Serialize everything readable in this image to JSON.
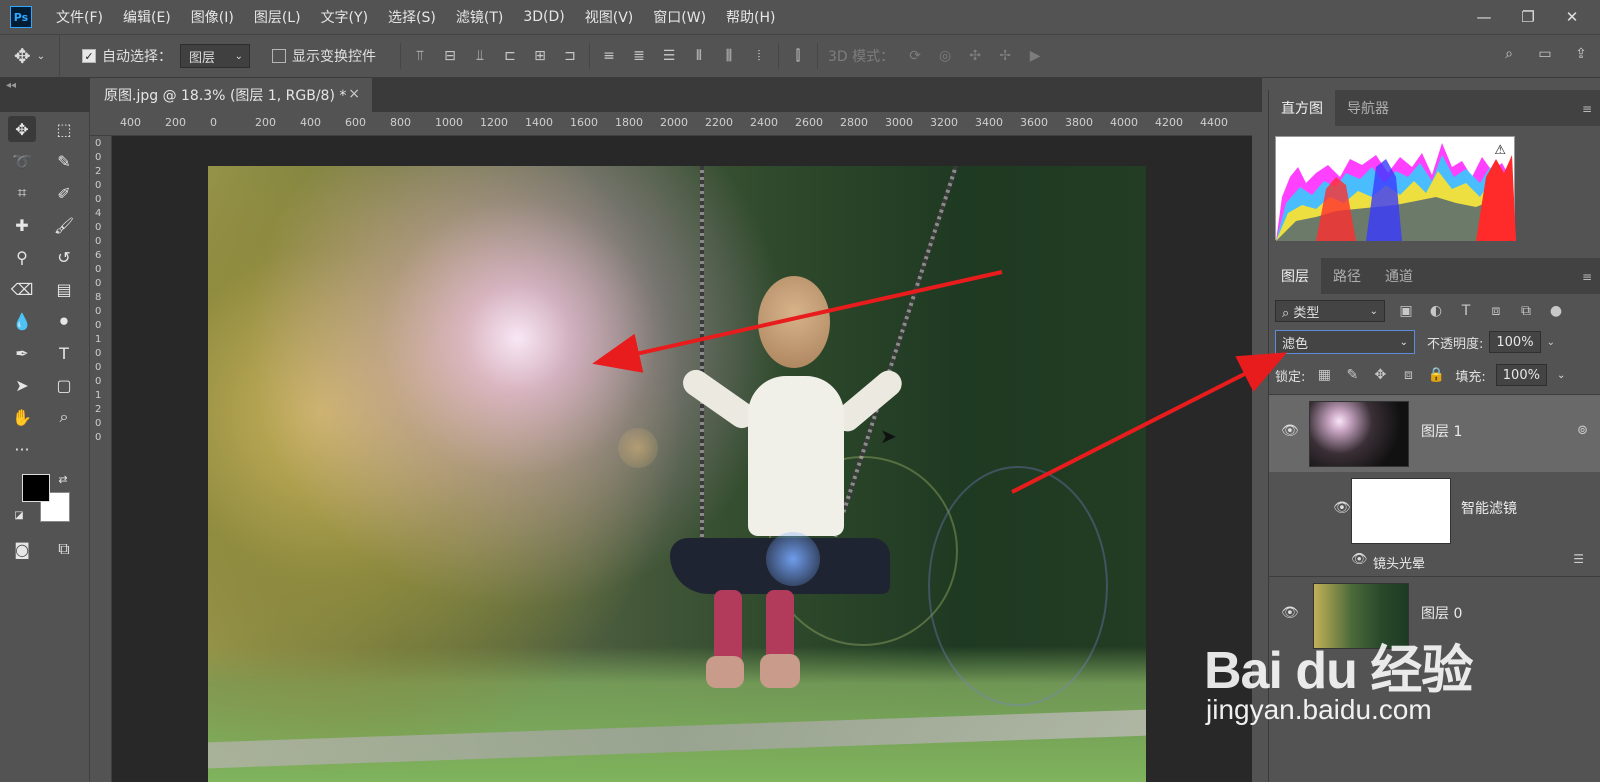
{
  "app": {
    "logo": "Ps",
    "menu": [
      "文件(F)",
      "编辑(E)",
      "图像(I)",
      "图层(L)",
      "文字(Y)",
      "选择(S)",
      "滤镜(T)",
      "3D(D)",
      "视图(V)",
      "窗口(W)",
      "帮助(H)"
    ]
  },
  "options": {
    "auto_select_label": "自动选择：",
    "auto_select_value": "图层",
    "show_transform_label": "显示变换控件",
    "mode_3d_label": "3D 模式："
  },
  "document": {
    "tab_title": "原图.jpg @ 18.3% (图层 1, RGB/8) *",
    "close_glyph": "×"
  },
  "ruler": {
    "h_ticks": [
      "400",
      "200",
      "0",
      "200",
      "400",
      "600",
      "800",
      "1000",
      "1200",
      "1400",
      "1600",
      "1800",
      "2000",
      "2200",
      "2400",
      "2600",
      "2800",
      "3000",
      "3200",
      "3400",
      "3600",
      "3800",
      "4000",
      "4200",
      "4400"
    ],
    "v_ticks": [
      "0",
      "0",
      "2",
      "0",
      "0",
      "4",
      "0",
      "0",
      "6",
      "0",
      "0",
      "8",
      "0",
      "0",
      "1",
      "0",
      "0",
      "0",
      "1",
      "2",
      "0",
      "0"
    ]
  },
  "panels": {
    "top_tabs": [
      "直方图",
      "导航器"
    ],
    "layer_tabs": [
      "图层",
      "路径",
      "通道"
    ],
    "filter_label": "类型",
    "blend_mode": "滤色",
    "opacity_label": "不透明度:",
    "opacity_value": "100%",
    "lock_label": "锁定:",
    "fill_label": "填充:",
    "fill_value": "100%"
  },
  "layers": [
    {
      "name": "图层 1",
      "selected": true
    },
    {
      "name": "智能滤镜",
      "selected": false
    },
    {
      "name": "镜头光晕",
      "selected": false
    },
    {
      "name": "图层 0",
      "selected": false
    }
  ],
  "watermark": {
    "main": "Bai du 经验",
    "sub": "jingyan.baidu.com"
  },
  "colors": {
    "accent_blue": "#31a8ff",
    "annotation_red": "#e81c1c"
  }
}
